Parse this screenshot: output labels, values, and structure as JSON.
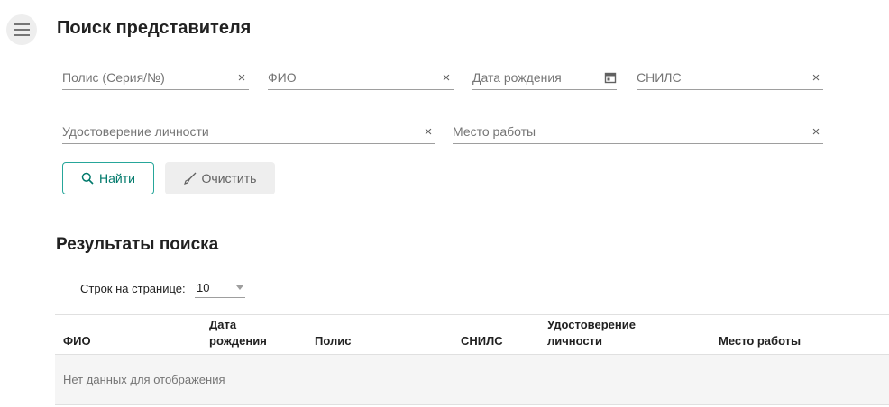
{
  "header": {
    "menu_icon": "hamburger-menu-icon",
    "title": "Поиск представителя"
  },
  "search_form": {
    "policy": {
      "placeholder": "Полис (Серия/№)"
    },
    "fio": {
      "placeholder": "ФИО"
    },
    "birth_date": {
      "placeholder": "Дата рождения"
    },
    "snils": {
      "placeholder": "СНИЛС"
    },
    "identity_document": {
      "placeholder": "Удостоверение личности"
    },
    "workplace": {
      "placeholder": "Место работы"
    },
    "clear_icon": "×",
    "search_button": {
      "label": "Найти",
      "icon": "search-icon"
    },
    "clear_button": {
      "label": "Очистить",
      "icon": "broom-icon"
    }
  },
  "results": {
    "title": "Результаты поиска",
    "rows_per_page_label": "Строк на странице:",
    "rows_per_page_value": "10",
    "columns": [
      "ФИО",
      "Дата рождения",
      "Полис",
      "СНИЛС",
      "Удостоверение личности",
      "Место работы"
    ],
    "empty_text": "Нет данных для отображения"
  },
  "colors": {
    "accent": "#26a69a",
    "accent_text": "#00796b"
  }
}
